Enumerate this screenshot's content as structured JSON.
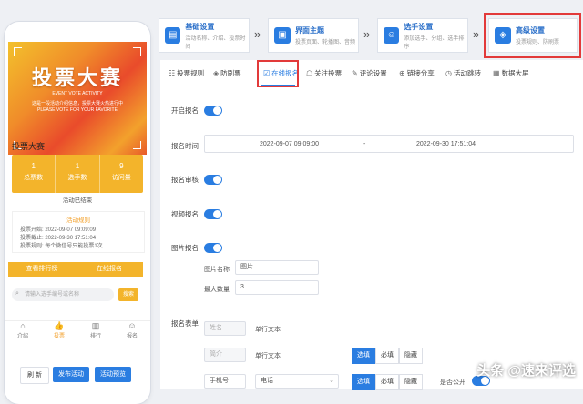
{
  "phone": {
    "banner": {
      "title": "投票大赛",
      "tagline": "EVENT VOTE ACTIVITY",
      "desc_line1": "这是一段活动介绍信息，投票大赛火热进行中",
      "desc_line2": "PLEASE VOTE FOR YOUR FAVORITE"
    },
    "activity_title": "投票大赛",
    "stats": [
      {
        "value": "1",
        "label": "总票数"
      },
      {
        "value": "1",
        "label": "选手数"
      },
      {
        "value": "9",
        "label": "访问量"
      }
    ],
    "ended_text": "活动已结束",
    "rules_title": "活动规则",
    "rules": [
      "投票开始: 2022-09-07 09:09:09",
      "投票截止: 2022-09-30 17:51:04",
      "投票规则: 每个微信号只能投票1次"
    ],
    "action_bar": [
      "查看排行榜",
      "在线报名"
    ],
    "search": {
      "placeholder": "请输入选手编号或名称",
      "button": "搜索"
    },
    "tabbar": [
      {
        "icon": "⌂",
        "label": "介绍"
      },
      {
        "icon": "👍",
        "label": "投票"
      },
      {
        "icon": "▥",
        "label": "排行"
      },
      {
        "icon": "☺",
        "label": "报名"
      }
    ]
  },
  "bottom_buttons": [
    "刷 新",
    "发布活动",
    "活动预览"
  ],
  "steps": [
    {
      "title": "基础设置",
      "sub": "活动名称、介绍、投票时间"
    },
    {
      "title": "界面主题",
      "sub": "投票页面、轮播图、音频"
    },
    {
      "title": "选手设置",
      "sub": "添加选手、分组、选手排序"
    },
    {
      "title": "高级设置",
      "sub": "投票规则、防刷票"
    }
  ],
  "tabs": [
    {
      "icon": "☷",
      "label": "投票规则"
    },
    {
      "icon": "◈",
      "label": "防刷票"
    },
    {
      "icon": "☑",
      "label": "在线报名"
    },
    {
      "icon": "☖",
      "label": "关注投票"
    },
    {
      "icon": "✎",
      "label": "评论设置"
    },
    {
      "icon": "⊕",
      "label": "链接分享"
    },
    {
      "icon": "◷",
      "label": "活动跳转"
    },
    {
      "icon": "▦",
      "label": "数据大屏"
    }
  ],
  "form": {
    "enable_signup": "开启报名",
    "signup_time": "报名时间",
    "time_start": "2022-09-07 09:09:00",
    "time_sep": "-",
    "time_end": "2022-09-30 17:51:04",
    "review": "报名审核",
    "video_signup": "视频报名",
    "image_signup": "图片报名",
    "image_name_label": "图片名称",
    "image_name_value": "图片",
    "max_count_label": "最大数量",
    "max_count_value": "3",
    "signup_form": "报名表单",
    "rows": [
      {
        "field": "姓名",
        "type": "单行文本"
      },
      {
        "field": "简介",
        "type": "单行文本",
        "options": [
          "选填",
          "必填",
          "隐藏"
        ]
      },
      {
        "field": "手机号",
        "type": "电话",
        "options": [
          "选填",
          "必填",
          "隐藏"
        ],
        "public_label": "是否公开"
      }
    ]
  },
  "watermark": "头条 @速来评选",
  "colors": {
    "primary": "#2a7de1",
    "orange": "#f3b42b",
    "highlight": "#e23a3a"
  }
}
